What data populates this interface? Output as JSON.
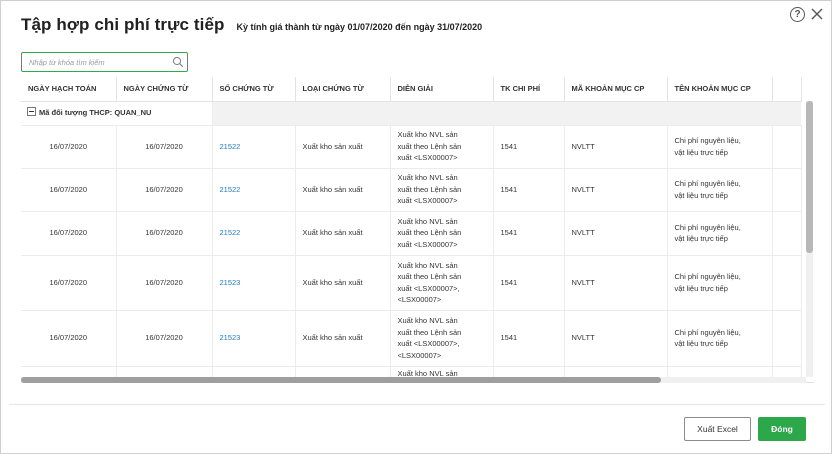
{
  "dialog": {
    "title": "Tập hợp chi phí trực tiếp",
    "subtitle": "Kỳ tính giá thành từ ngày 01/07/2020 đến ngày 31/07/2020",
    "help_symbol": "?"
  },
  "search": {
    "placeholder": "Nhập từ khóa tìm kiếm",
    "value": ""
  },
  "columns": [
    "NGÀY HẠCH TOÁN",
    "NGÀY CHỨNG TỪ",
    "SỐ CHỨNG TỪ",
    "LOẠI CHỨNG TỪ",
    "DIỄN GIẢI",
    "TK CHI PHÍ",
    "MÃ KHOẢN MỤC CP",
    "TÊN KHOẢN MỤC CP"
  ],
  "group": {
    "label": "Mã đối tượng THCP: QUAN_NU"
  },
  "rows": [
    {
      "ngay_hach_toan": "16/07/2020",
      "ngay_chung_tu": "16/07/2020",
      "so_chung_tu": "21522",
      "loai_chung_tu": "Xuất kho sản xuất",
      "dien_giai": [
        "Xuất kho NVL sản",
        "xuất theo Lệnh sản",
        "xuất <LSX00007>"
      ],
      "tk_chi_phi": "1541",
      "ma_khoan_muc": "NVLTT",
      "ten_khoan_muc": [
        "Chi phí nguyên liệu,",
        "vật liệu trực tiếp"
      ]
    },
    {
      "ngay_hach_toan": "16/07/2020",
      "ngay_chung_tu": "16/07/2020",
      "so_chung_tu": "21522",
      "loai_chung_tu": "Xuất kho sản xuất",
      "dien_giai": [
        "Xuất kho NVL sản",
        "xuất theo Lệnh sản",
        "xuất <LSX00007>"
      ],
      "tk_chi_phi": "1541",
      "ma_khoan_muc": "NVLTT",
      "ten_khoan_muc": [
        "Chi phí nguyên liệu,",
        "vật liệu trực tiếp"
      ]
    },
    {
      "ngay_hach_toan": "16/07/2020",
      "ngay_chung_tu": "16/07/2020",
      "so_chung_tu": "21522",
      "loai_chung_tu": "Xuất kho sản xuất",
      "dien_giai": [
        "Xuất kho NVL sản",
        "xuất theo Lệnh sản",
        "xuất <LSX00007>"
      ],
      "tk_chi_phi": "1541",
      "ma_khoan_muc": "NVLTT",
      "ten_khoan_muc": [
        "Chi phí nguyên liệu,",
        "vật liệu trực tiếp"
      ]
    },
    {
      "ngay_hach_toan": "16/07/2020",
      "ngay_chung_tu": "16/07/2020",
      "so_chung_tu": "21523",
      "loai_chung_tu": "Xuất kho sản xuất",
      "dien_giai": [
        "Xuất kho NVL sản",
        "xuất theo Lệnh sản",
        "xuất <LSX00007>,",
        "<LSX00007>"
      ],
      "tk_chi_phi": "1541",
      "ma_khoan_muc": "NVLTT",
      "ten_khoan_muc": [
        "Chi phí nguyên liệu,",
        "vật liệu trực tiếp"
      ]
    },
    {
      "ngay_hach_toan": "16/07/2020",
      "ngay_chung_tu": "16/07/2020",
      "so_chung_tu": "21523",
      "loai_chung_tu": "Xuất kho sản xuất",
      "dien_giai": [
        "Xuất kho NVL sản",
        "xuất theo Lệnh sản",
        "xuất <LSX00007>,",
        "<LSX00007>"
      ],
      "tk_chi_phi": "1541",
      "ma_khoan_muc": "NVLTT",
      "ten_khoan_muc": [
        "Chi phí nguyên liệu,",
        "vật liệu trực tiếp"
      ]
    },
    {
      "dien_giai": [
        "Xuất kho NVL sản"
      ]
    }
  ],
  "buttons": {
    "export_excel": "Xuất Excel",
    "close": "Đóng"
  },
  "colors": {
    "accent_green": "#2ca84a",
    "link_blue": "#1f7cc0",
    "group_row_bg": "#f2f2f2"
  }
}
